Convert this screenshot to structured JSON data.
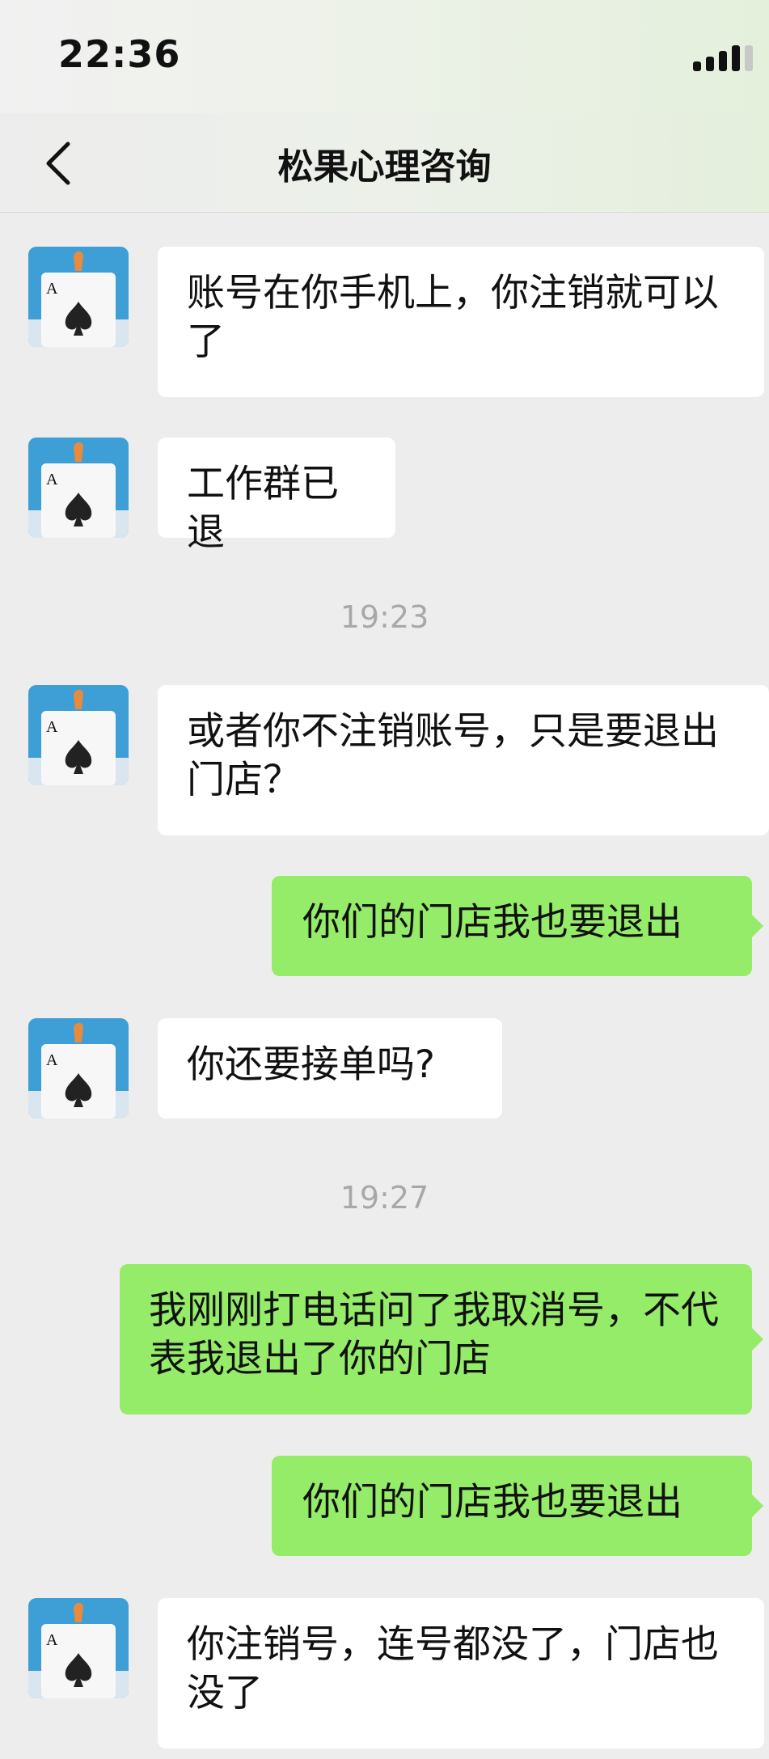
{
  "status_bar": {
    "time": "22:36"
  },
  "nav": {
    "title": "松果心理咨询"
  },
  "messages": [
    {
      "text": "账号在你手机上，你注销就可以了"
    },
    {
      "text": "工作群已退"
    },
    {
      "timestamp": "19:23"
    },
    {
      "text": "或者你不注销账号，只是要退出门店？"
    },
    {
      "text": "你们的门店我也要退出"
    },
    {
      "text": "你还要接单吗?"
    },
    {
      "timestamp": "19:27"
    },
    {
      "text": "我刚刚打电话问了我取消号，不代表我退出了你的门店"
    },
    {
      "text": "你们的门店我也要退出"
    },
    {
      "text": "你注销号，连号都没了，门店也没了"
    }
  ],
  "colors": {
    "background": "#ededed",
    "outgoing_bubble": "#95ec69",
    "incoming_bubble": "#ffffff",
    "timestamp": "#a8a8a8"
  },
  "icons": {
    "back": "chevron-left-icon",
    "signal": "signal-bars-icon",
    "avatar": "ace-of-spades-avatar"
  }
}
